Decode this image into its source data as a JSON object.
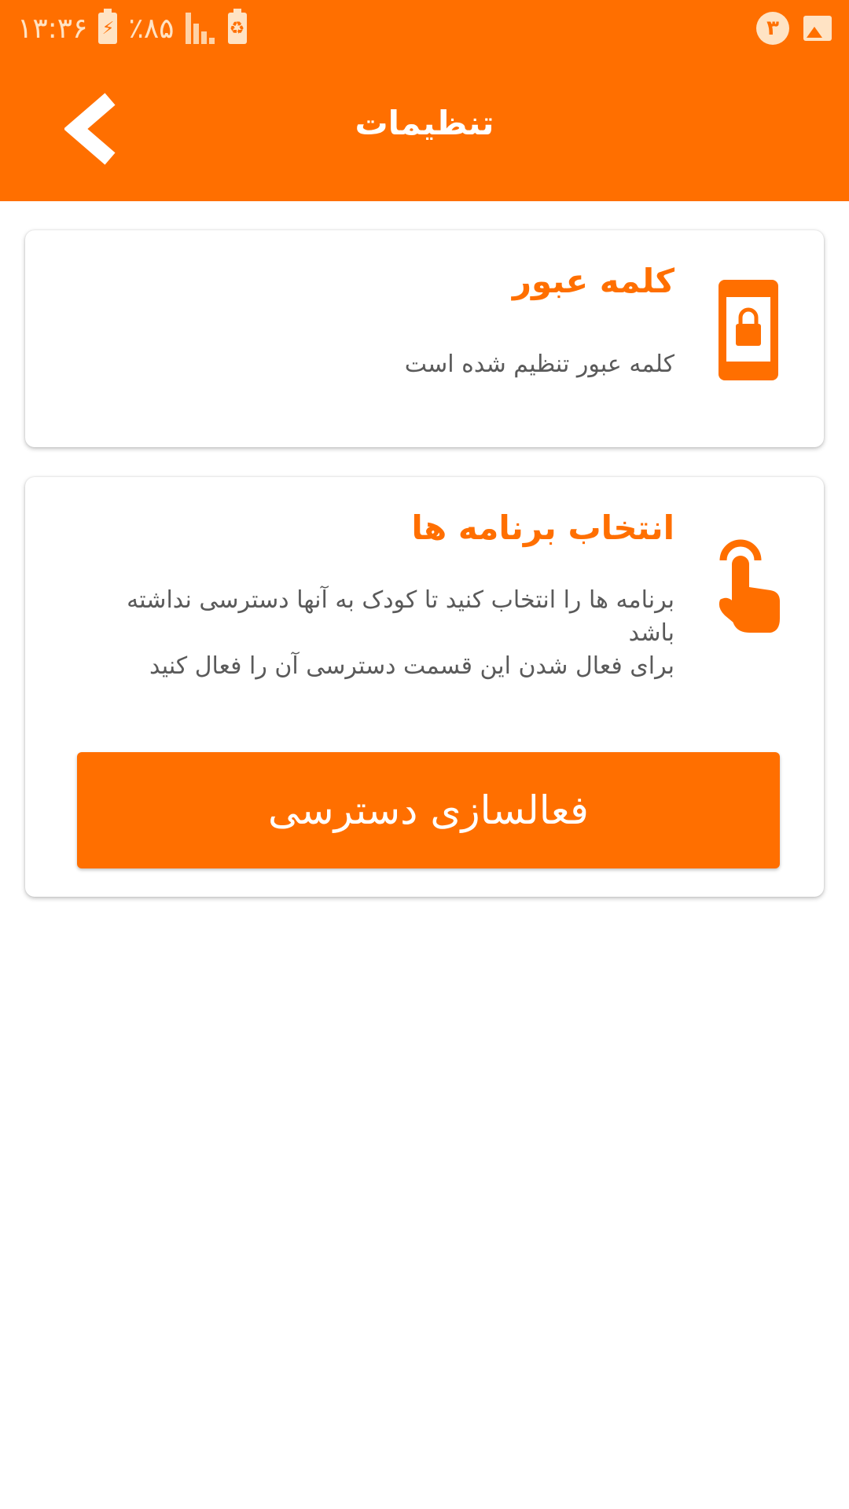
{
  "status_bar": {
    "time": "۱۳:۳۶",
    "battery": "٪۸۵",
    "notification_count": "۳"
  },
  "app_bar": {
    "title": "تنظیمات"
  },
  "password_card": {
    "title": "کلمه عبور",
    "description": "کلمه عبور تنظیم شده است"
  },
  "apps_card": {
    "title": "انتخاب برنامه ها",
    "description_line1": "برنامه ها را انتخاب کنید تا کودک به آنها دسترسی نداشته باشد",
    "description_line2": "برای فعال شدن این قسمت دسترسی آن را فعال کنید",
    "button_label": "فعالسازی دسترسی"
  },
  "colors": {
    "accent": "#ff6f00",
    "text_secondary": "#5a5a5a",
    "background": "#ffffff"
  }
}
